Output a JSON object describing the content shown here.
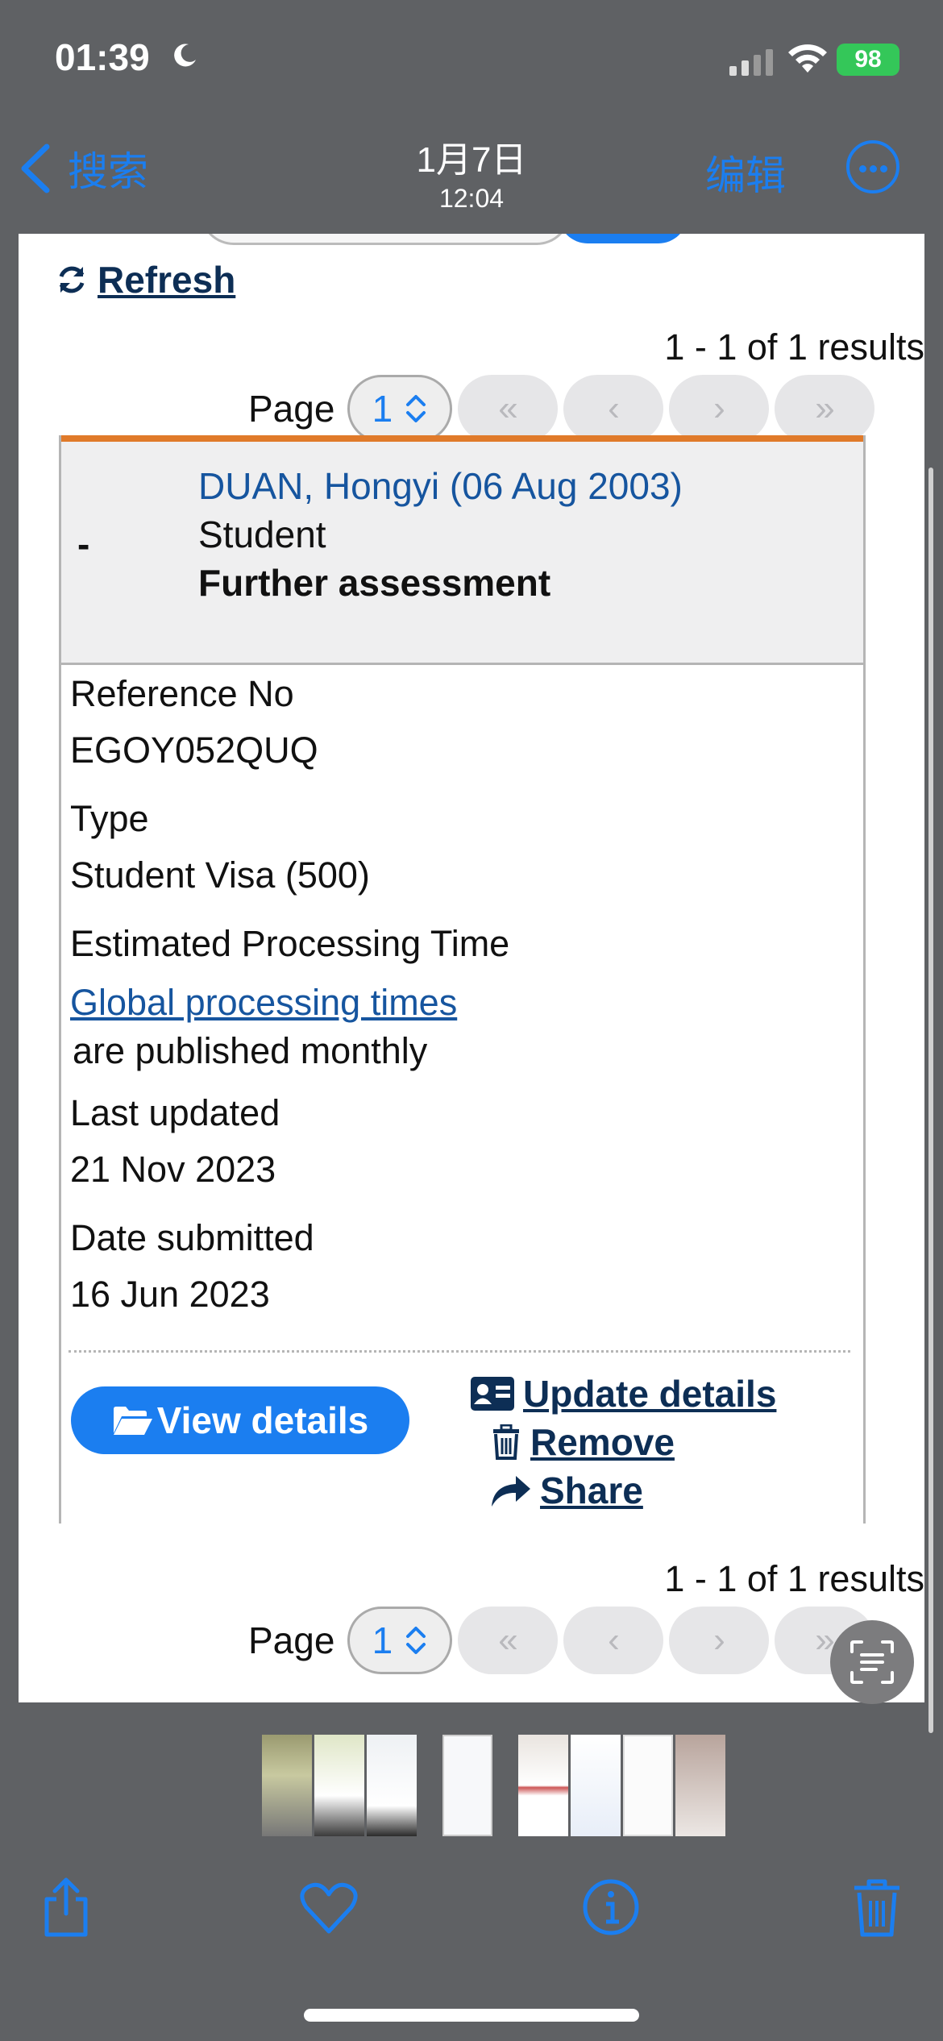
{
  "status_bar": {
    "time": "01:39",
    "battery": "98"
  },
  "nav": {
    "back_label": "搜索",
    "date": "1月7日",
    "time": "12:04",
    "edit_label": "编辑"
  },
  "toolbar_top": {
    "refresh_label": "Refresh"
  },
  "pagination_top": {
    "results": "1 - 1 of 1 results",
    "page_label": "Page",
    "page_value": "1",
    "first": "«",
    "prev": "‹",
    "next": "›",
    "last": "»"
  },
  "application": {
    "collapse_symbol": "-",
    "applicant": "DUAN, Hongyi (06 Aug 2003)",
    "role": "Student",
    "status": "Further assessment",
    "reference_label": "Reference No",
    "reference_value": "EGOY052QUQ",
    "type_label": "Type",
    "type_value": "Student Visa (500)",
    "processing_label": "Estimated Processing Time",
    "processing_link": "Global processing times",
    "processing_note": "are published monthly",
    "updated_label": "Last updated",
    "updated_value": "21 Nov 2023",
    "submitted_label": "Date submitted",
    "submitted_value": "16 Jun 2023",
    "view_details_label": "View details",
    "update_details_label": "Update details",
    "remove_label": "Remove",
    "share_label": "Share"
  },
  "pagination_bottom": {
    "results": "1 - 1 of 1 results",
    "page_label": "Page",
    "page_value": "1",
    "first": "«",
    "prev": "‹",
    "next": "›",
    "last": "»"
  },
  "colors": {
    "ios_blue": "#1b7ef0",
    "link_navy": "#0d2e55",
    "applicant_blue": "#16559f",
    "accent_orange": "#e07a2a",
    "battery_green": "#34c759"
  },
  "icons": [
    "moon-icon",
    "signal-icon",
    "wifi-icon",
    "chevron-left-icon",
    "more-icon",
    "refresh-icon",
    "updown-chevron-icon",
    "folder-open-icon",
    "id-card-icon",
    "trash-icon",
    "share-arrow-icon",
    "live-text-icon",
    "share-icon",
    "heart-icon",
    "info-icon",
    "delete-icon"
  ]
}
